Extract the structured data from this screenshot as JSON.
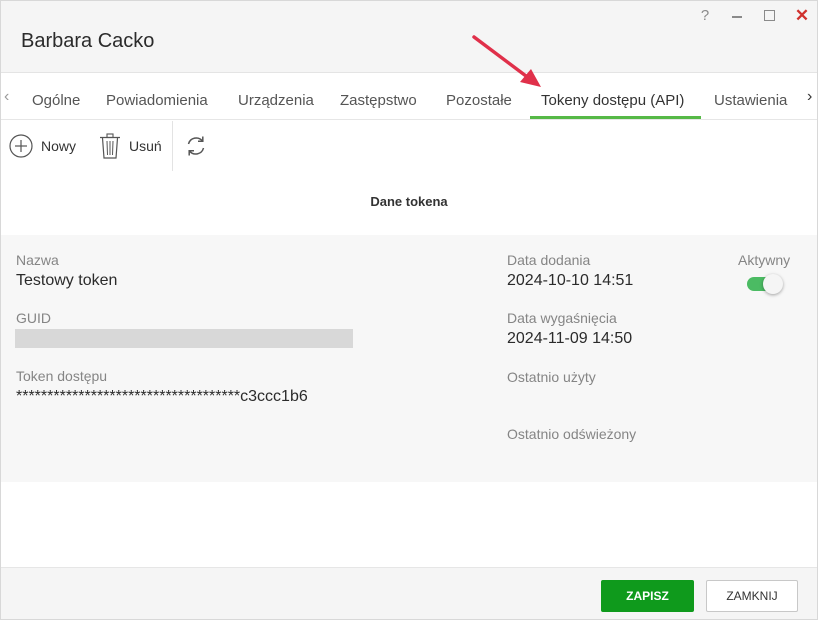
{
  "window": {
    "title": "Barbara Cacko",
    "help_label": "?",
    "close_label": "✕"
  },
  "tabs": {
    "items": [
      {
        "label": "Ogólne"
      },
      {
        "label": "Powiadomienia"
      },
      {
        "label": "Urządzenia"
      },
      {
        "label": "Zastępstwo"
      },
      {
        "label": "Pozostałe"
      },
      {
        "label": "Tokeny dostępu (API)"
      },
      {
        "label": "Ustawienia"
      }
    ],
    "active": "Tokeny dostępu (API)",
    "accent_color": "#56b947"
  },
  "toolbar": {
    "new_label": "Nowy",
    "delete_label": "Usuń"
  },
  "token": {
    "section_title": "Dane tokena",
    "name_label": "Nazwa",
    "name_value": "Testowy token",
    "guid_label": "GUID",
    "access_token_label": "Token dostępu",
    "access_token_value": "************************************c3ccc1b6",
    "date_added_label": "Data dodania",
    "date_added_value": "2024-10-10 14:51",
    "expiry_label": "Data wygaśnięcia",
    "expiry_value": "2024-11-09 14:50",
    "last_used_label": "Ostatnio użyty",
    "last_refreshed_label": "Ostatnio odświeżony",
    "active_label": "Aktywny",
    "active_value": true
  },
  "footer": {
    "save_label": "ZAPISZ",
    "close_label": "ZAMKNIJ",
    "save_color": "#0f9a1c"
  },
  "annotation": {
    "arrow_color": "#e0304a"
  }
}
